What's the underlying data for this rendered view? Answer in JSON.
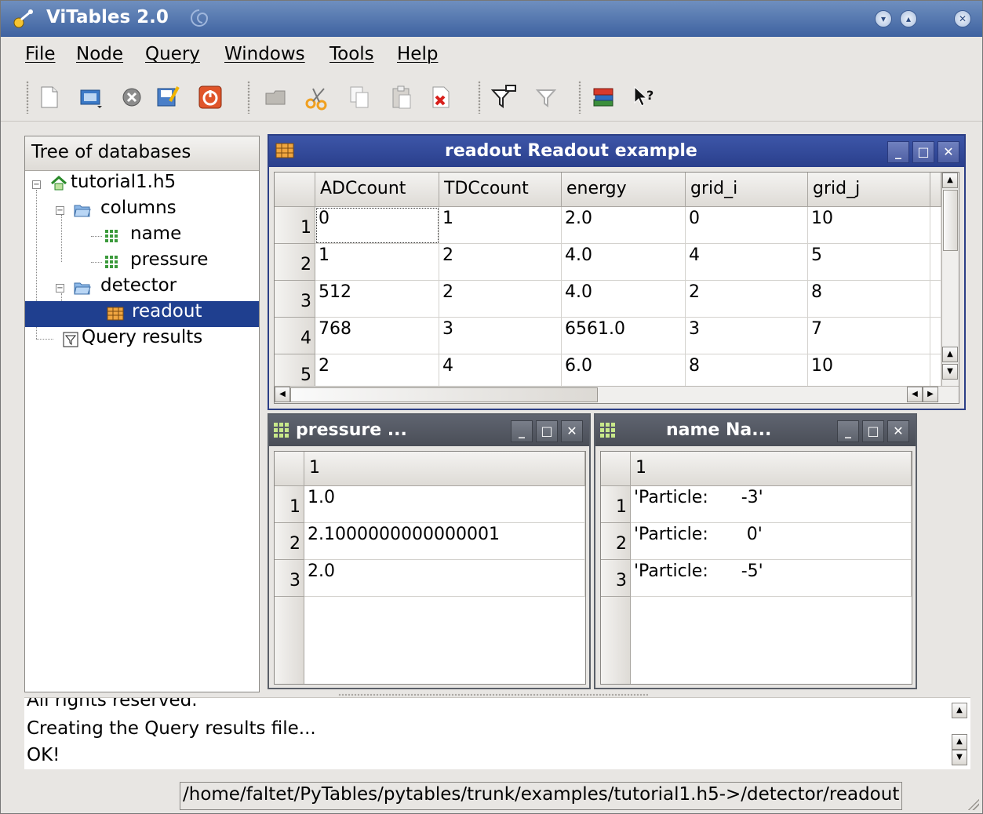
{
  "window": {
    "title": "ViTables 2.0"
  },
  "menu": [
    "File",
    "Node",
    "Query",
    "Windows",
    "Tools",
    "Help"
  ],
  "toolbar_icons": [
    "new-file-icon",
    "open-file-icon",
    "close-file-icon",
    "save-as-icon",
    "quit-icon",
    "open-node-icon",
    "cut-icon",
    "copy-icon",
    "paste-icon",
    "delete-icon",
    "new-query-icon",
    "delete-query-icon",
    "manual-icon",
    "whats-this-icon"
  ],
  "tree": {
    "header": "Tree of databases",
    "nodes": {
      "file": "tutorial1.h5",
      "columns": "columns",
      "name": "name",
      "pressure": "pressure",
      "detector": "detector",
      "readout": "readout",
      "query": "Query results"
    }
  },
  "readout": {
    "title": "readout Readout example",
    "columns": [
      "ADCcount",
      "TDCcount",
      "energy",
      "grid_i",
      "grid_j"
    ],
    "rows": [
      {
        "n": "1",
        "cells": [
          "0",
          "1",
          "2.0",
          "0",
          "10"
        ]
      },
      {
        "n": "2",
        "cells": [
          "1",
          "2",
          "4.0",
          "4",
          "5"
        ]
      },
      {
        "n": "3",
        "cells": [
          "512",
          "2",
          "4.0",
          "2",
          "8"
        ]
      },
      {
        "n": "4",
        "cells": [
          "768",
          "3",
          "6561.0",
          "3",
          "7"
        ]
      },
      {
        "n": "5",
        "cells": [
          "2",
          "4",
          "6.0",
          "8",
          "10"
        ]
      }
    ]
  },
  "pressure": {
    "title": "pressure ...",
    "column": "1",
    "rows": [
      {
        "n": "1",
        "v": "1.0"
      },
      {
        "n": "2",
        "v": "2.1000000000000001"
      },
      {
        "n": "3",
        "v": "2.0"
      }
    ]
  },
  "name": {
    "title": "name Na...",
    "column": "1",
    "rows": [
      {
        "n": "1",
        "v": "'Particle:      -3'"
      },
      {
        "n": "2",
        "v": "'Particle:       0'"
      },
      {
        "n": "3",
        "v": "'Particle:      -5'"
      }
    ]
  },
  "log": [
    "All rights reserved.",
    "Creating the Query results file...",
    "OK!"
  ],
  "status": {
    "path": "/home/faltet/PyTables/pytables/trunk/examples/tutorial1.h5->/detector/readout"
  }
}
